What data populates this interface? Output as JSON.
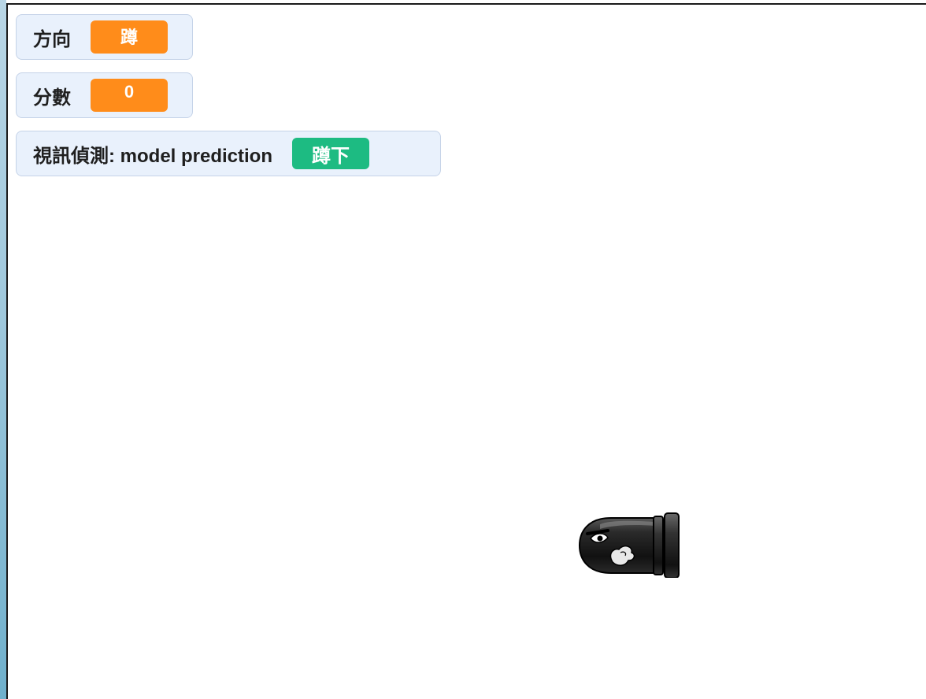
{
  "monitors": {
    "direction": {
      "label": "方向",
      "value": "蹲",
      "color": "#ff8c1a"
    },
    "score": {
      "label": "分數",
      "value": "0",
      "color": "#ff8c1a"
    },
    "video_detection": {
      "label": "視訊偵測: model prediction",
      "value": "蹲下",
      "color": "#1dbb82"
    }
  },
  "sprites": [
    {
      "name": "bullet-bill",
      "icon": "bullet-bill-icon"
    }
  ]
}
